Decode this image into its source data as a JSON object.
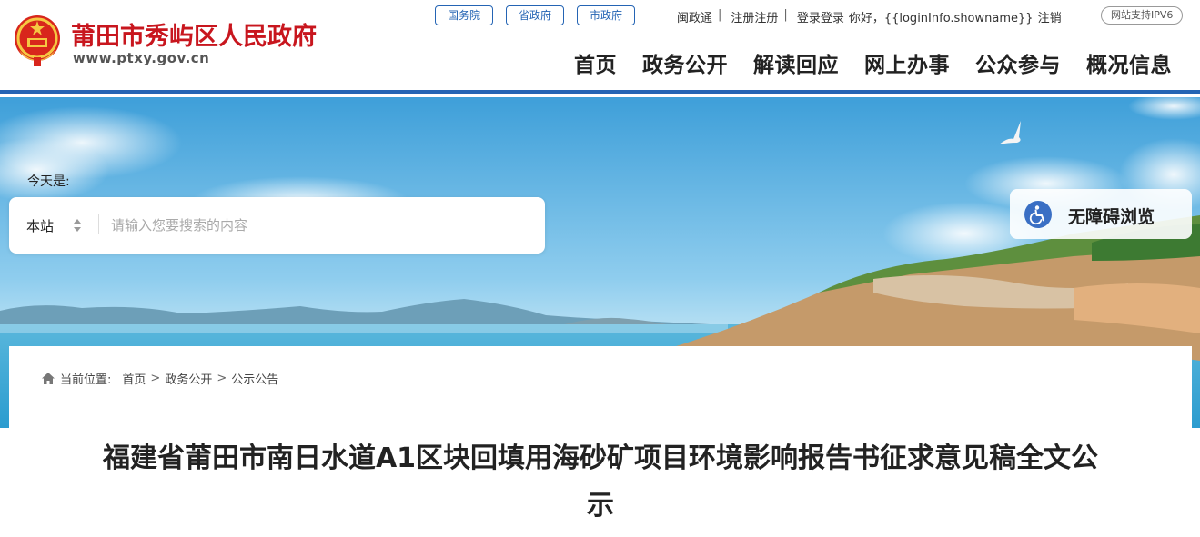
{
  "header": {
    "site_title": "莆田市秀屿区人民政府",
    "site_url": "www.ptxy.gov.cn",
    "top_links": [
      "国务院",
      "省政府",
      "市政府"
    ],
    "user_links": [
      "闽政通",
      "注册注册",
      "登录登录",
      "你好，{{loginInfo.showname}}",
      "注销"
    ],
    "ipv6_badge": "网站支持IPV6",
    "nav": [
      "首页",
      "政务公开",
      "解读回应",
      "网上办事",
      "公众参与",
      "概况信息"
    ],
    "colors": {
      "brand_red": "#c8161e",
      "accent_blue": "#2464b4"
    }
  },
  "banner": {
    "today_label": "今天是:",
    "search": {
      "scope": "本站",
      "placeholder": "请输入您要搜索的内容"
    },
    "accessibility_button": "无障碍浏览"
  },
  "content": {
    "breadcrumb": {
      "label": "当前位置:",
      "items": [
        "首页",
        "政务公开",
        "公示公告"
      ]
    },
    "article_title": "福建省莆田市南日水道A1区块回填用海砂矿项目环境影响报告书征求意见稿全文公示"
  }
}
